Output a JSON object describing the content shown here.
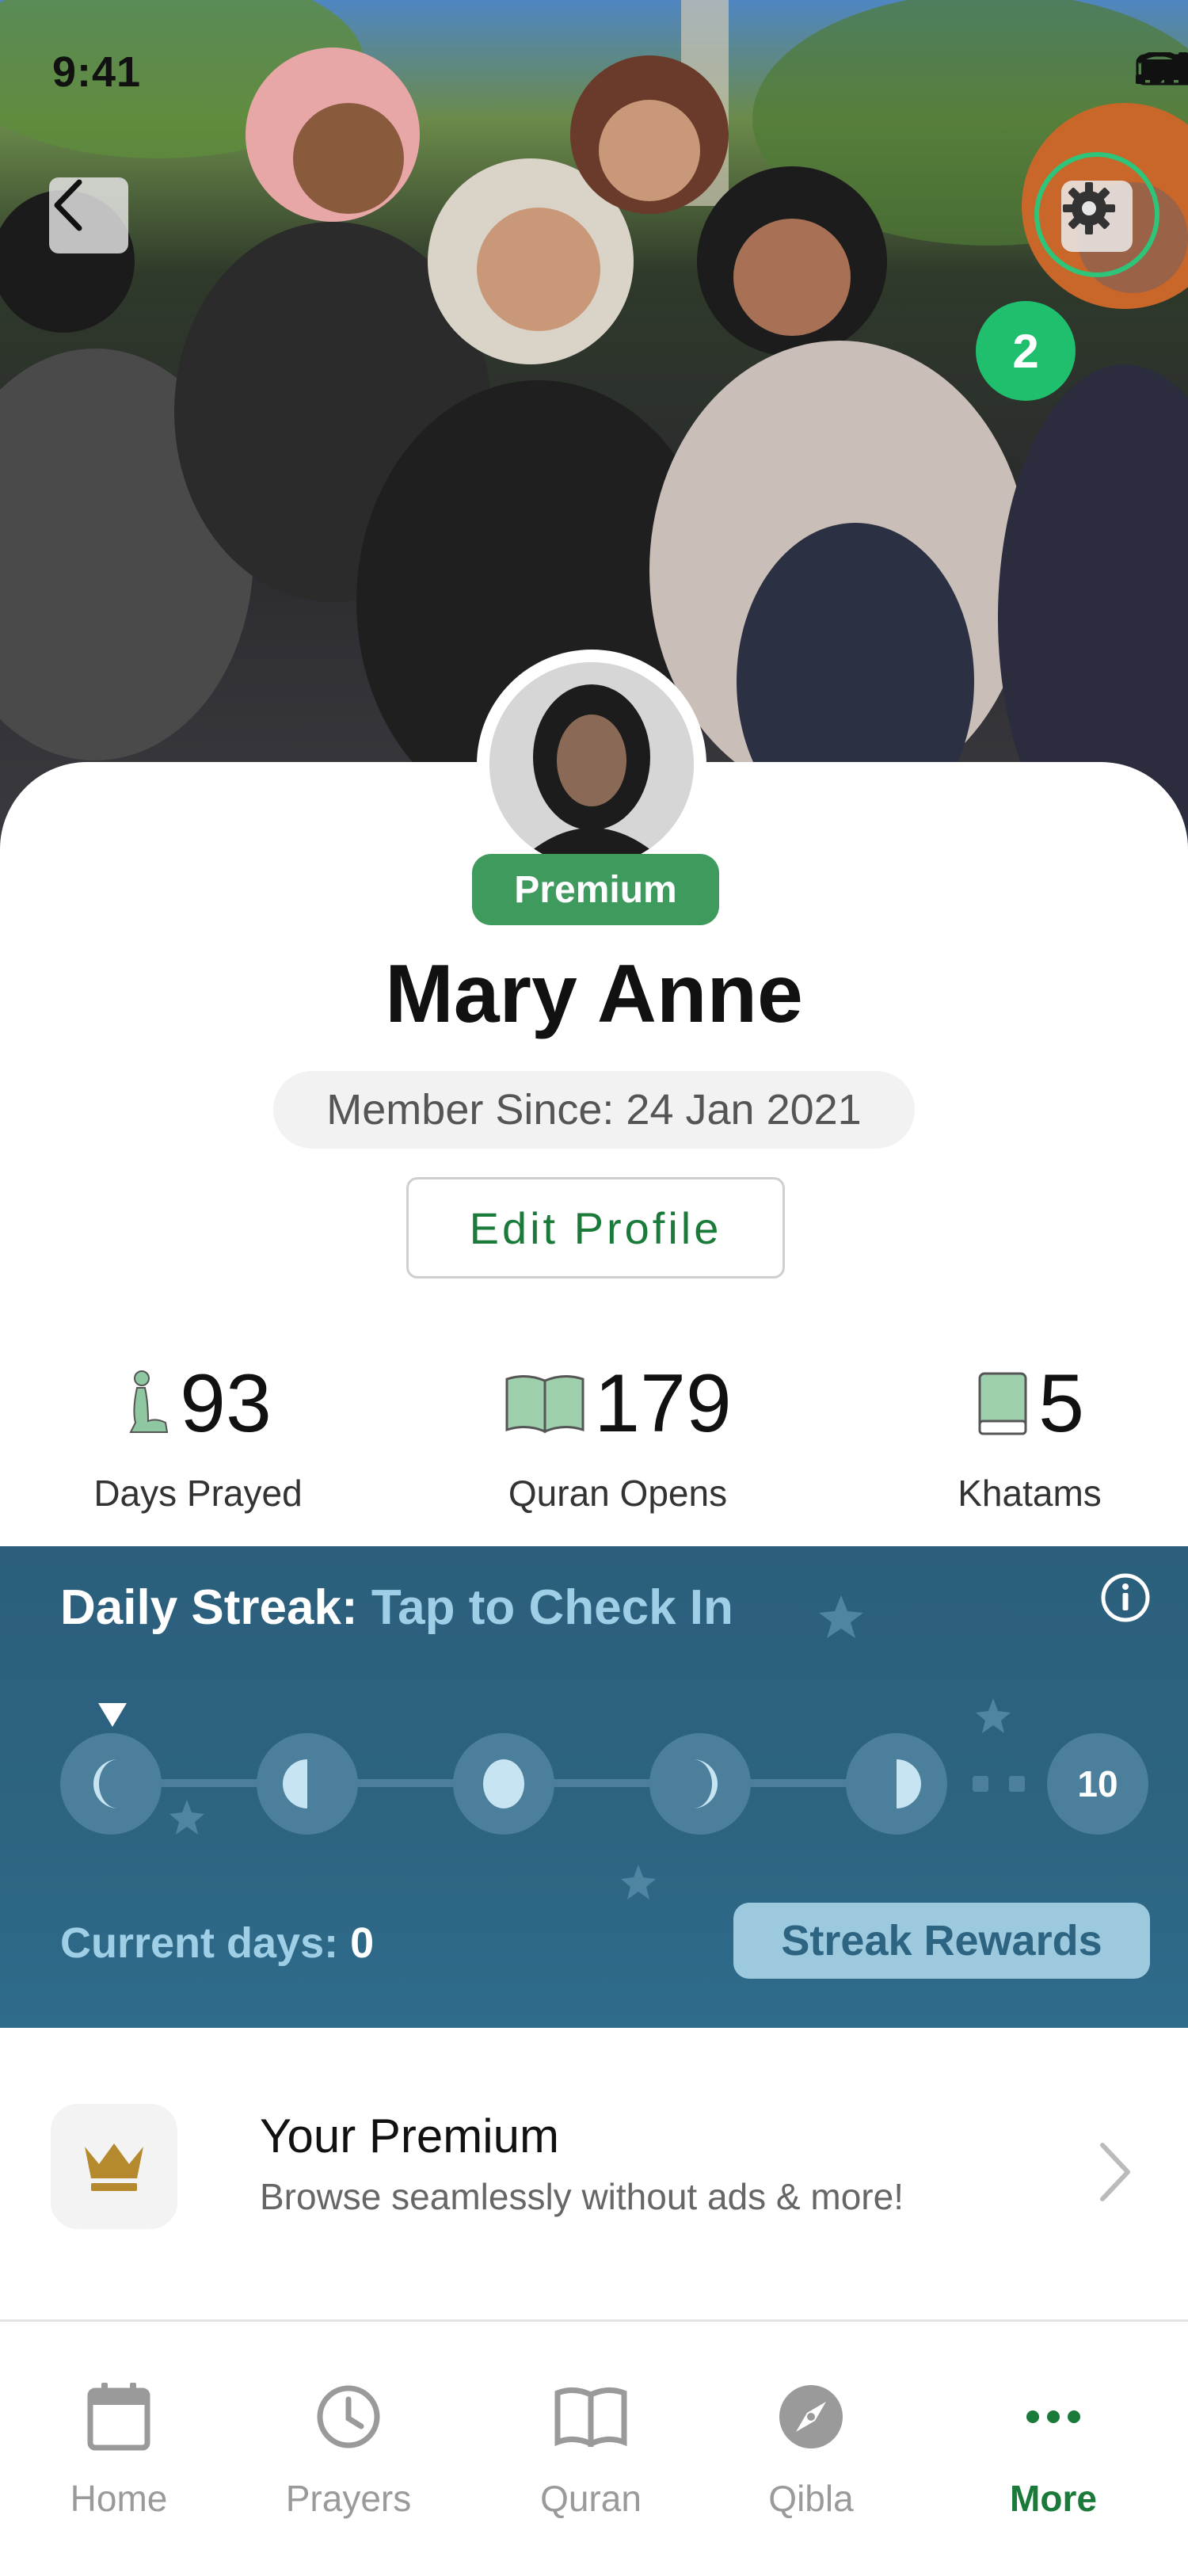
{
  "status_bar": {
    "time": "9:41"
  },
  "header": {
    "notification_count": "2"
  },
  "profile": {
    "badge": "Premium",
    "name": "Mary Anne",
    "member_since": "Member Since: 24 Jan 2021",
    "edit_button": "Edit Profile"
  },
  "stats": [
    {
      "value": "93",
      "label": "Days Prayed",
      "icon": "prayer-person-icon"
    },
    {
      "value": "179",
      "label": "Quran Opens",
      "icon": "open-book-icon"
    },
    {
      "value": "5",
      "label": "Khatams",
      "icon": "closed-book-icon"
    }
  ],
  "streak": {
    "title_prefix": "Daily Streak:",
    "title_action": "Tap to Check In",
    "goal_days": "10",
    "current_label": "Current days:",
    "current_value": "0",
    "rewards_button": "Streak Rewards"
  },
  "premium_row": {
    "title": "Your Premium",
    "subtitle": "Browse seamlessly without ads & more!"
  },
  "tabs": [
    {
      "label": "Home",
      "icon": "calendar-icon",
      "active": false
    },
    {
      "label": "Prayers",
      "icon": "clock-icon",
      "active": false
    },
    {
      "label": "Quran",
      "icon": "book-icon",
      "active": false
    },
    {
      "label": "Qibla",
      "icon": "compass-icon",
      "active": false
    },
    {
      "label": "More",
      "icon": "more-dots-icon",
      "active": true
    }
  ],
  "colors": {
    "brand_green": "#1a7a3a",
    "premium_green": "#3f9a5d",
    "notification_green": "#1fbf6e",
    "streak_blue": "#2d6482",
    "streak_accent": "#9fcfe6"
  }
}
